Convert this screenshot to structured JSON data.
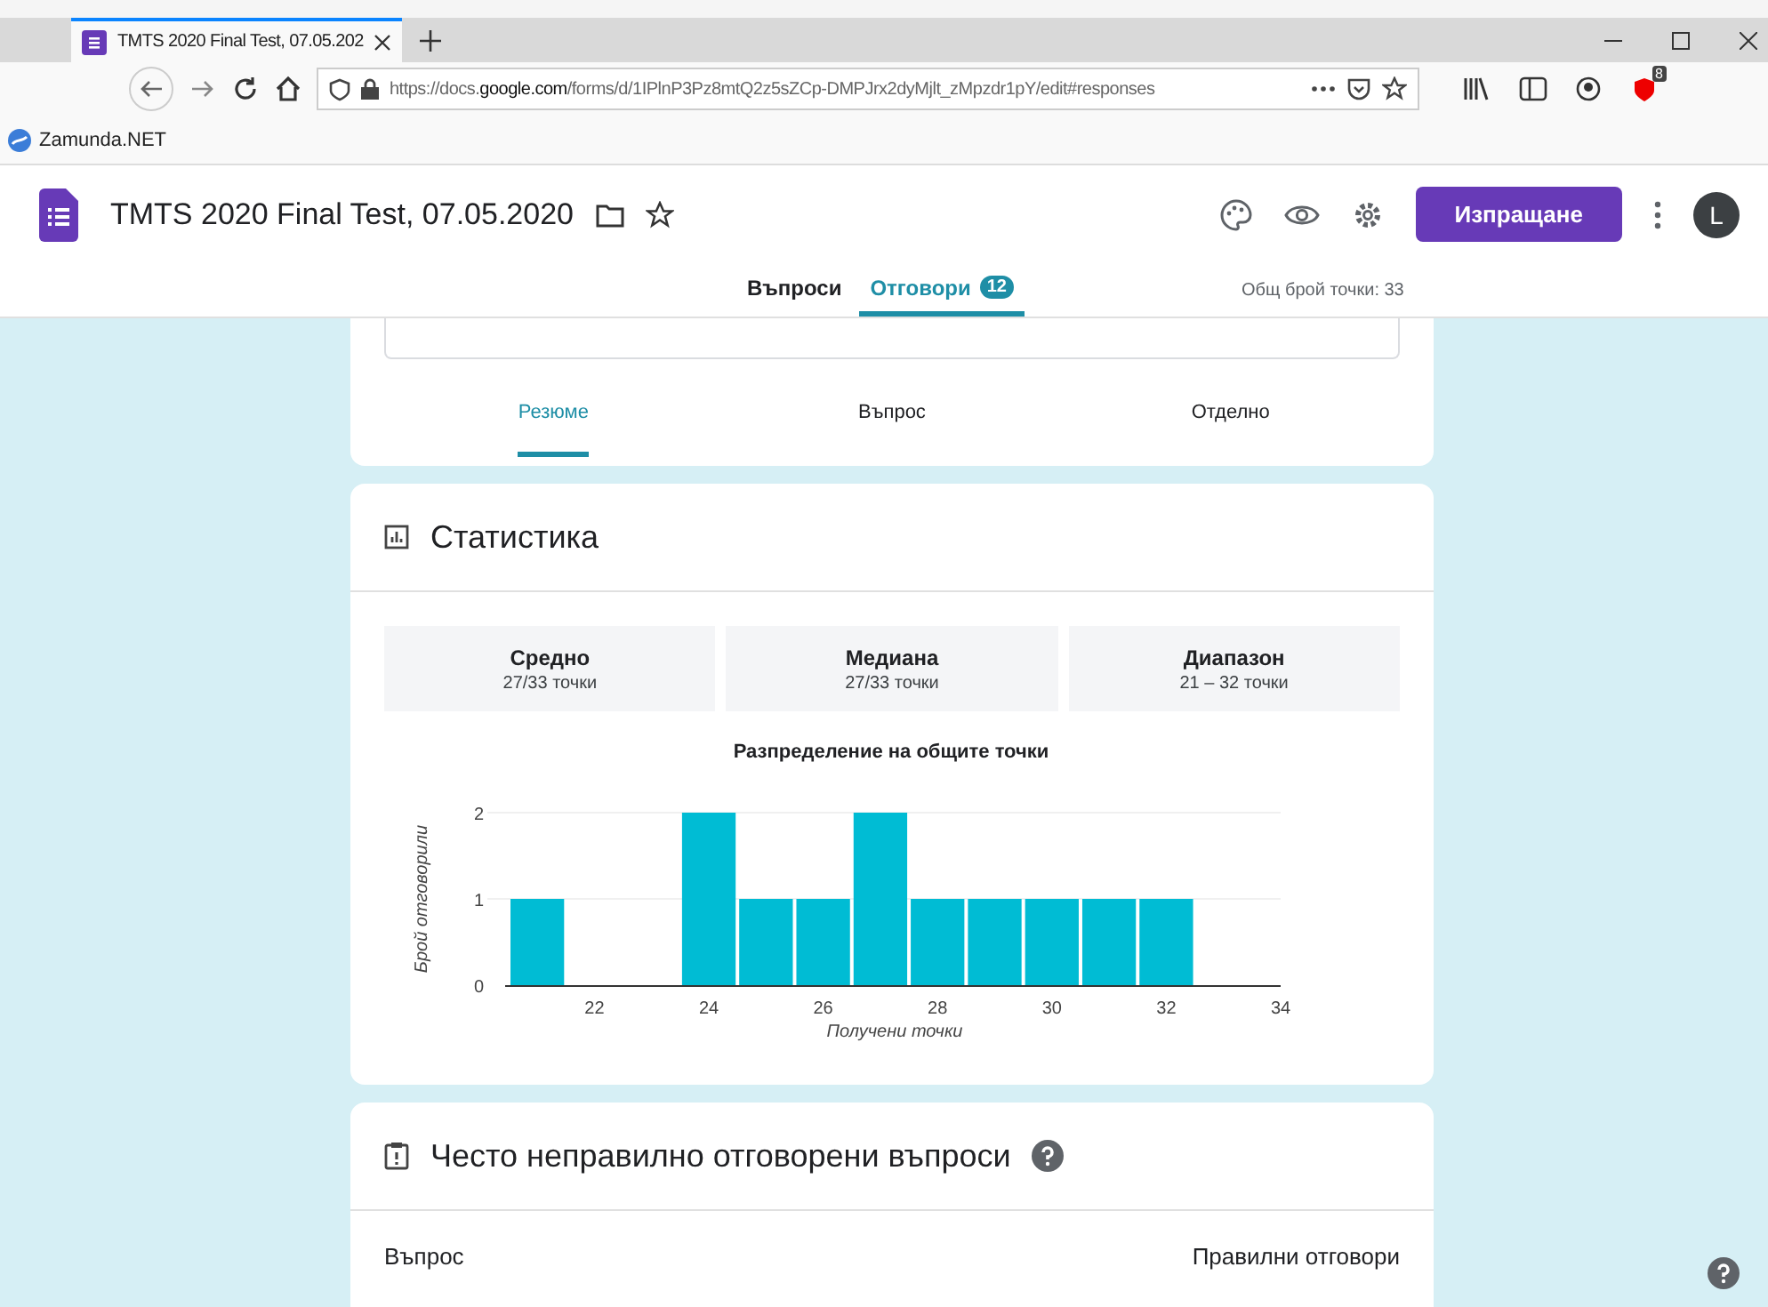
{
  "browser": {
    "tab_title": "TMTS 2020 Final Test, 07.05.202",
    "url": "https://docs.**google.com**/forms/d/1IPlnP3Pz8mtQ2z5sZCp-DMPJrx2dyMjlt_zMpzdr1pY/edit#responses",
    "extension_badge": "8",
    "bookmarks": [
      "Zamunda.NET"
    ]
  },
  "form_header": {
    "title": "TMTS 2020 Final Test, 07.05.2020",
    "send_button": "Изпращане",
    "avatar": "L"
  },
  "form_tabs": [
    {
      "label": "Въпроси",
      "selected": false
    },
    {
      "label": "Отговори",
      "selected": true,
      "badge": "12"
    }
  ],
  "total_points": "Общ брой точки: 33",
  "response_views": [
    {
      "label": "Резюме",
      "selected": true
    },
    {
      "label": "Въпрос",
      "selected": false
    },
    {
      "label": "Отделно",
      "selected": false
    }
  ],
  "statistics": {
    "title": "Статистика",
    "stats": [
      {
        "label": "Средно",
        "value": "27/33 точки"
      },
      {
        "label": "Медиана",
        "value": "27/33 точки"
      },
      {
        "label": "Диапазон",
        "value": "21 – 32 точки"
      }
    ],
    "chart_data": {
      "type": "bar",
      "title": "Разпределение на общите точки",
      "xlabel": "Получени точки",
      "ylabel": "Брой отговорили",
      "x": [
        21,
        22,
        23,
        24,
        25,
        26,
        27,
        28,
        29,
        30,
        31,
        32
      ],
      "series": [
        {
          "color": "#00bcd4",
          "values": [
            1,
            0,
            0,
            2,
            1,
            1,
            2,
            1,
            1,
            1,
            1,
            1
          ]
        }
      ],
      "xlim": [
        20.5,
        34
      ],
      "ylim": [
        0,
        2
      ],
      "xticks": [
        22,
        24,
        26,
        28,
        30,
        32,
        34
      ],
      "yticks": [
        0,
        1,
        2
      ]
    }
  },
  "frequently_missed": {
    "title": "Често неправилно отговорени въпроси",
    "columns": [
      "Въпрос",
      "Правилни отговори"
    ]
  }
}
